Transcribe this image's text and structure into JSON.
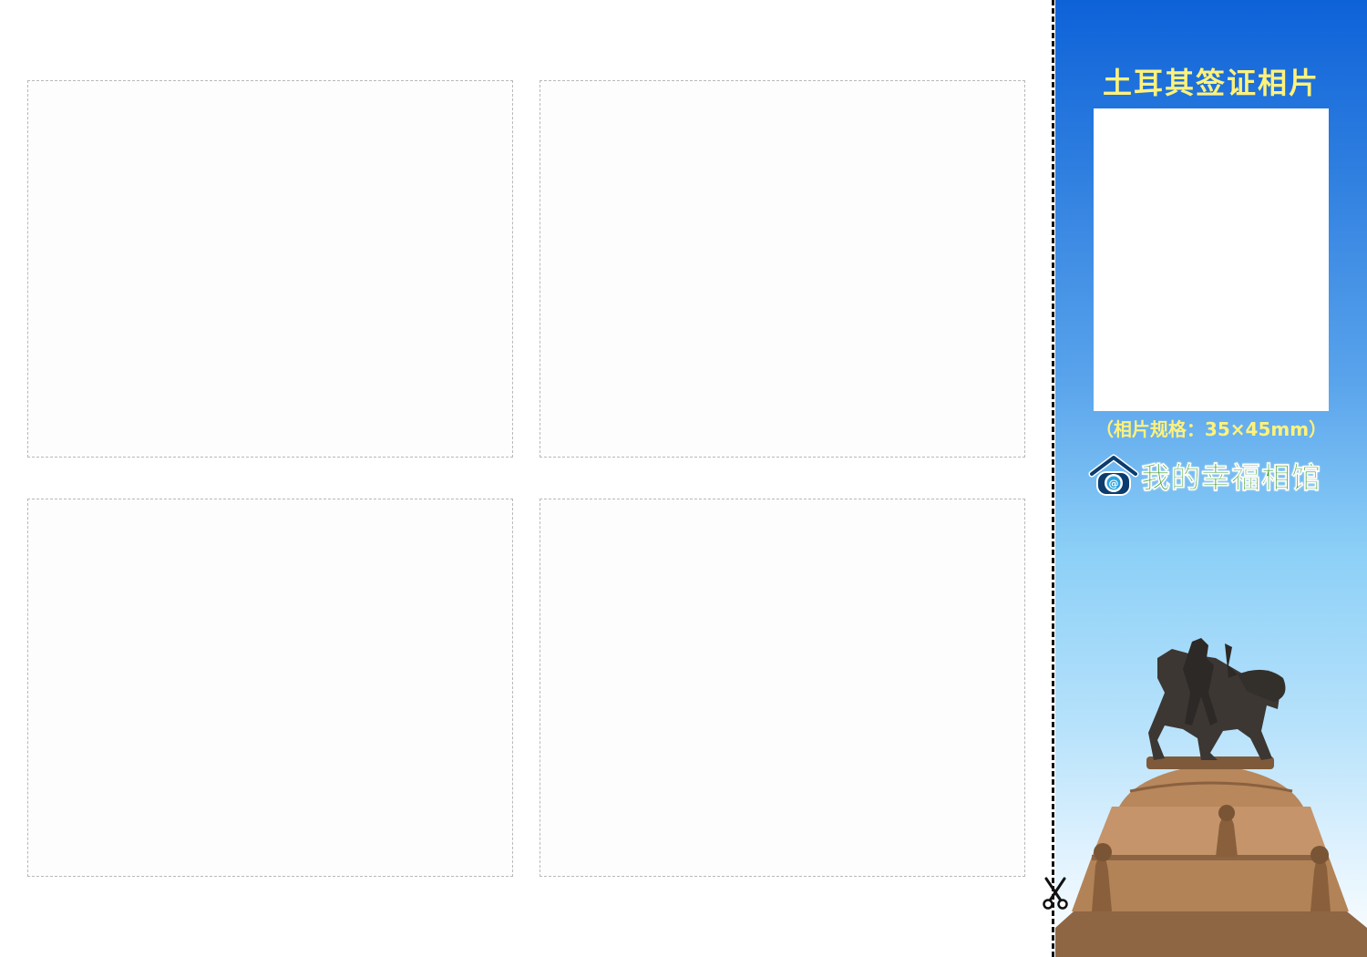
{
  "panel": {
    "title": "土耳其签证相片",
    "spec_caption": "（相片规格：35×45mm）",
    "brand_name": "我的幸福相馆",
    "title_color": "#fff27a",
    "brand_color": "#3b9a26"
  },
  "photo_slots": [
    {
      "slot": "photo-box-1"
    },
    {
      "slot": "photo-box-2"
    },
    {
      "slot": "photo-box-3"
    },
    {
      "slot": "photo-box-4"
    }
  ],
  "icons": {
    "cut": "scissors-icon",
    "brand": "house-at-logo-icon",
    "illustration": "equestrian-statue-image"
  }
}
